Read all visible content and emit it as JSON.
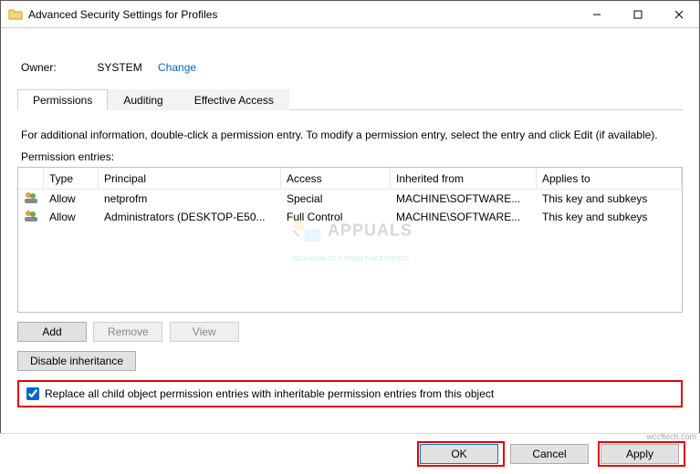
{
  "window": {
    "title": "Advanced Security Settings for Profiles"
  },
  "owner": {
    "label": "Owner:",
    "value": "SYSTEM",
    "change": "Change"
  },
  "tabs": {
    "t0": "Permissions",
    "t1": "Auditing",
    "t2": "Effective Access"
  },
  "info": "For additional information, double-click a permission entry. To modify a permission entry, select the entry and click Edit (if available).",
  "entries_label": "Permission entries:",
  "headers": {
    "type": "Type",
    "principal": "Principal",
    "access": "Access",
    "inherited": "Inherited from",
    "applies": "Applies to"
  },
  "rows": [
    {
      "type": "Allow",
      "principal": "netprofm",
      "access": "Special",
      "inherited": "MACHINE\\SOFTWARE...",
      "applies": "This key and subkeys"
    },
    {
      "type": "Allow",
      "principal": "Administrators (DESKTOP-E50...",
      "access": "Full Control",
      "inherited": "MACHINE\\SOFTWARE...",
      "applies": "This key and subkeys"
    }
  ],
  "buttons": {
    "add": "Add",
    "remove": "Remove",
    "view": "View",
    "disable": "Disable inheritance"
  },
  "checkbox": {
    "label": "Replace all child object permission entries with inheritable permission entries from this object"
  },
  "footer": {
    "ok": "OK",
    "cancel": "Cancel",
    "apply": "Apply"
  },
  "watermark": {
    "brand": "APPUALS",
    "sub": "TECH HOW-TO'S FROM THE EXPERTS",
    "src": "wccftech.com"
  }
}
